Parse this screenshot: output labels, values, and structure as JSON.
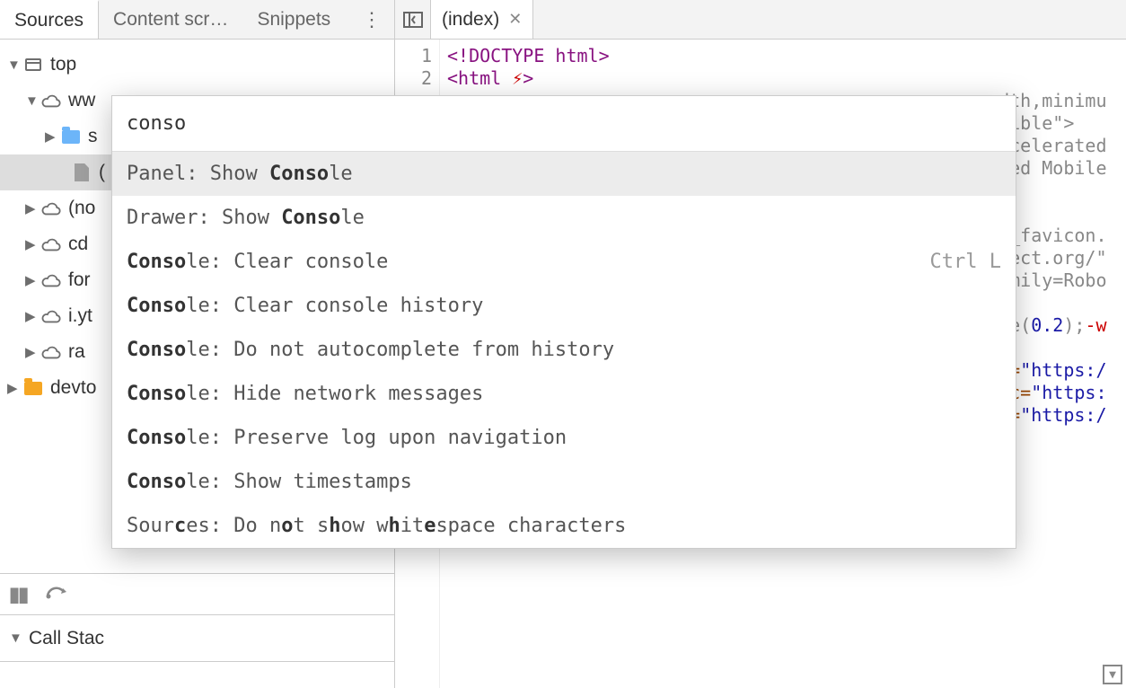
{
  "tabs": {
    "sources": "Sources",
    "content_scripts": "Content scr…",
    "snippets": "Snippets"
  },
  "tree": {
    "top": "top",
    "items": [
      {
        "label": "ww",
        "icon": "cloud",
        "expanded": true
      },
      {
        "label": "s",
        "icon": "folder-blue",
        "child": true
      },
      {
        "label": "(",
        "icon": "file",
        "child": true,
        "selected": true
      },
      {
        "label": "(no",
        "icon": "cloud"
      },
      {
        "label": "cd",
        "icon": "cloud"
      },
      {
        "label": "for",
        "icon": "cloud"
      },
      {
        "label": "i.yt",
        "icon": "cloud"
      },
      {
        "label": "ra",
        "icon": "cloud"
      }
    ],
    "devtools": "devto"
  },
  "callstack_label": "Call Stac",
  "file_tab": "(index)",
  "gutter": [
    "1",
    "2"
  ],
  "code_lines": {
    "l1": "<!DOCTYPE html>",
    "l2_a": "<html ",
    "l2_err": "⚡",
    "frag1": "dth,minimu",
    "frag2": "tible\">",
    "frag3": "ccelerated",
    "frag4": "ted Mobile",
    "frag5": ">",
    "frag6": "p_favicon.",
    "frag7": "ject.org/\"",
    "frag8": "amily=Robo",
    "frag9a": "le(",
    "frag9b": "0.2",
    "frag9c": ");",
    "frag9d": "-w",
    "frag10a": "c=",
    "frag10b": "\"https:/",
    "frag11a": "rc=",
    "frag11b": "\"https:",
    "frag12a": "c=",
    "frag12b": "\"https:/"
  },
  "palette": {
    "query": "conso",
    "items": [
      {
        "prefix": "Panel: Show ",
        "bold": "Conso",
        "suffix": "le",
        "shortcut": "",
        "selected": true
      },
      {
        "prefix": "Drawer: Show ",
        "bold": "Conso",
        "suffix": "le",
        "shortcut": ""
      },
      {
        "prefix": "",
        "bold": "Conso",
        "suffix": "le: Clear console",
        "shortcut": "Ctrl L"
      },
      {
        "prefix": "",
        "bold": "Conso",
        "suffix": "le: Clear console history",
        "shortcut": ""
      },
      {
        "prefix": "",
        "bold": "Conso",
        "suffix": "le: Do not autocomplete from history",
        "shortcut": ""
      },
      {
        "prefix": "",
        "bold": "Conso",
        "suffix": "le: Hide network messages",
        "shortcut": ""
      },
      {
        "prefix": "",
        "bold": "Conso",
        "suffix": "le: Preserve log upon navigation",
        "shortcut": ""
      },
      {
        "prefix": "",
        "bold": "Conso",
        "suffix": "le: Show timestamps",
        "shortcut": ""
      },
      {
        "raw": "Sources: Do not show whitespace characters",
        "bold_positions": [
          4,
          13,
          17,
          22,
          25
        ],
        "shortcut": ""
      }
    ]
  }
}
